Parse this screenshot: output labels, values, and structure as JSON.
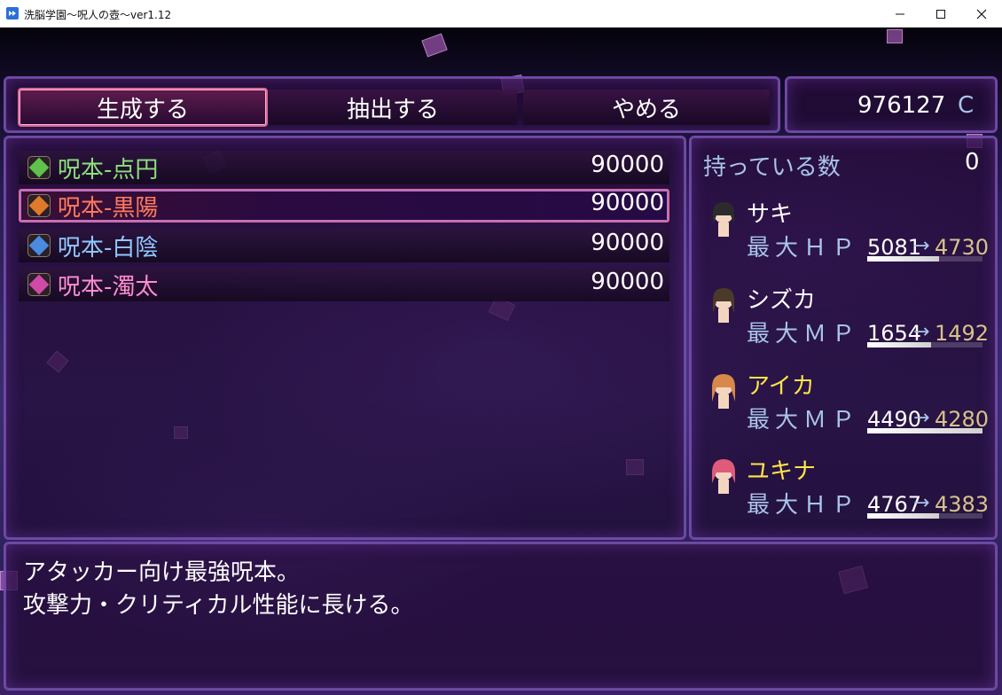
{
  "window": {
    "title": "洗脳学園～呪人の壺～ver1.12"
  },
  "commands": [
    {
      "label": "生成する",
      "selected": true
    },
    {
      "label": "抽出する",
      "selected": false
    },
    {
      "label": "やめる",
      "selected": false
    }
  ],
  "gold": {
    "amount": "976127",
    "unit": "C"
  },
  "items": [
    {
      "name": "呪本-点円",
      "price": "90000",
      "color": "#8de07a",
      "icon": "green-book-icon",
      "gem": "#5fc24a",
      "selected": false
    },
    {
      "name": "呪本-黒陽",
      "price": "90000",
      "color": "#ff7a5c",
      "icon": "orange-book-icon",
      "gem": "#e07a2a",
      "selected": true
    },
    {
      "name": "呪本-白陰",
      "price": "90000",
      "color": "#8fc8ff",
      "icon": "blue-book-icon",
      "gem": "#4a8ae0",
      "selected": false
    },
    {
      "name": "呪本-濁太",
      "price": "90000",
      "color": "#ff8cd0",
      "icon": "pink-book-icon",
      "gem": "#d04aa8",
      "selected": false
    }
  ],
  "owned": {
    "label": "持っている数",
    "count": "0"
  },
  "party": [
    {
      "name": "サキ",
      "name_color": "#ffffff",
      "param": "最大ＨＰ",
      "old": "5081",
      "arrow": "→",
      "new": "4730",
      "gauge": 0.62,
      "hair": "#2b2b2b"
    },
    {
      "name": "シズカ",
      "name_color": "#ffffff",
      "param": "最大ＭＰ",
      "old": "1654",
      "arrow": "→",
      "new": "1492",
      "gauge": 0.55,
      "hair": "#4a3a2a"
    },
    {
      "name": "アイカ",
      "name_color": "#ffe44a",
      "param": "最大ＭＰ",
      "old": "4490",
      "arrow": "→",
      "new": "4280",
      "gauge": 1.0,
      "hair": "#d8884a"
    },
    {
      "name": "ユキナ",
      "name_color": "#ffe44a",
      "param": "最大ＨＰ",
      "old": "4767",
      "arrow": "→",
      "new": "4383",
      "gauge": 0.62,
      "hair": "#e05a7a"
    }
  ],
  "description": {
    "line1": "アタッカー向け最強呪本。",
    "line2": "攻撃力・クリティカル性能に長ける。"
  }
}
